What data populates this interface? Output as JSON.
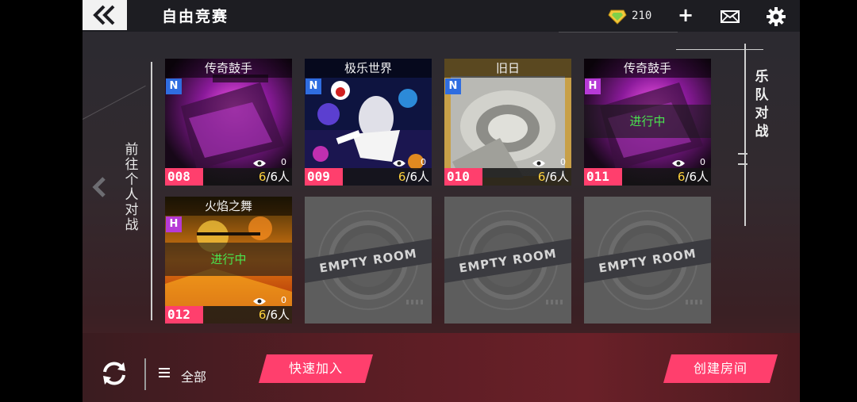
{
  "header": {
    "title": "自由竞赛",
    "currency": "210",
    "back_icon": "double-chevron-left-icon",
    "coin_icon": "gem-coin-icon",
    "add_icon": "plus-icon",
    "mail_icon": "mail-icon",
    "settings_icon": "gear-icon"
  },
  "side_nav": {
    "left_label": "前往个人对战",
    "right_label": "乐队对战"
  },
  "rooms": [
    {
      "number": "008",
      "title": "传奇鼓手",
      "mode": "N",
      "viewers": "0",
      "players_current": "6",
      "players_total": "/6人",
      "status": ""
    },
    {
      "number": "009",
      "title": "极乐世界",
      "mode": "N",
      "viewers": "0",
      "players_current": "6",
      "players_total": "/6人",
      "status": ""
    },
    {
      "number": "010",
      "title": "旧日",
      "mode": "N",
      "viewers": "0",
      "players_current": "6",
      "players_total": "/6人",
      "status": ""
    },
    {
      "number": "011",
      "title": "传奇鼓手",
      "mode": "H",
      "viewers": "0",
      "players_current": "6",
      "players_total": "/6人",
      "status": "进行中"
    },
    {
      "number": "012",
      "title": "火焰之舞",
      "mode": "H",
      "viewers": "0",
      "players_current": "6",
      "players_total": "/6人",
      "status": "进行中"
    }
  ],
  "empty_rooms": [
    {
      "label": "EMPTY ROOM"
    },
    {
      "label": "EMPTY ROOM"
    },
    {
      "label": "EMPTY ROOM"
    }
  ],
  "footer": {
    "filter_label": "全部",
    "quick_join_label": "快速加入",
    "create_room_label": "创建房间"
  },
  "colors": {
    "accent_pink": "#ff3f6d",
    "status_green": "#49e54f",
    "mode_normal": "#2f6de0",
    "mode_hard": "#b63ad6",
    "player_count": "#ffd23c"
  }
}
